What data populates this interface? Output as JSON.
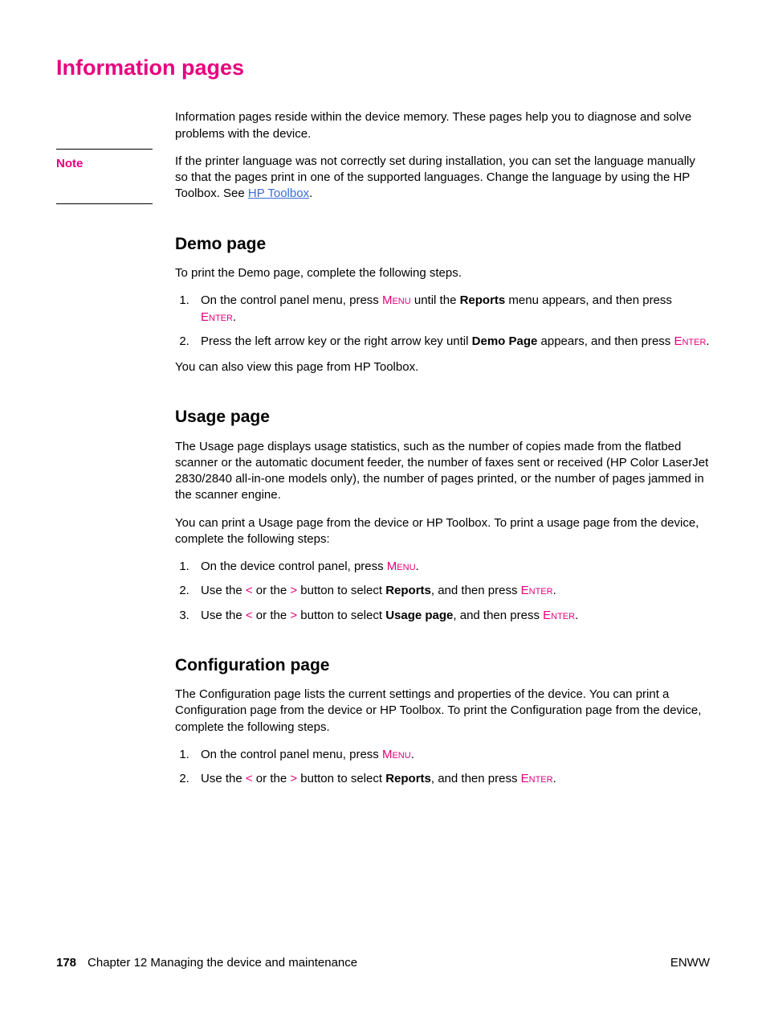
{
  "title": "Information pages",
  "intro": "Information pages reside within the device memory. These pages help you to diagnose and solve problems with the device.",
  "note": {
    "label": "Note",
    "body_pre": "If the printer language was not correctly set during installation, you can set the language manually so that the pages print in one of the supported languages. Change the language by using the HP Toolbox. See ",
    "link": "HP Toolbox",
    "body_post": "."
  },
  "demo": {
    "heading": "Demo page",
    "lead": "To print the Demo page, complete the following steps.",
    "step1_a": "On the control panel menu, press ",
    "step1_kw1": "Menu",
    "step1_b": " until the ",
    "step1_bold": "Reports",
    "step1_c": " menu appears, and then press ",
    "step1_kw2": "Enter",
    "step1_d": ".",
    "step2_a": "Press the left arrow key or the right arrow key until ",
    "step2_bold": "Demo Page",
    "step2_b": " appears, and then press ",
    "step2_kw": "Enter",
    "step2_c": ".",
    "tail": "You can also view this page from HP Toolbox."
  },
  "usage": {
    "heading": "Usage page",
    "p1": "The Usage page displays usage statistics, such as the number of copies made from the flatbed scanner or the automatic document feeder, the number of faxes sent or received (HP Color LaserJet 2830/2840 all-in-one models only), the number of pages printed, or the number of pages jammed in the scanner engine.",
    "p2": "You can print a Usage page from the device or HP Toolbox. To print a usage page from the device, complete the following steps:",
    "step1_a": "On the device control panel, press ",
    "step1_kw": "Menu",
    "step1_b": ".",
    "step2_a": "Use the ",
    "step2_lt": "<",
    "step2_b": " or the ",
    "step2_gt": ">",
    "step2_c": " button to select ",
    "step2_bold": "Reports",
    "step2_d": ", and then press ",
    "step2_kw": "Enter",
    "step2_e": ".",
    "step3_a": "Use the ",
    "step3_lt": "<",
    "step3_b": " or the ",
    "step3_gt": ">",
    "step3_c": " button to select ",
    "step3_bold": "Usage page",
    "step3_d": ", and then press ",
    "step3_kw": "Enter",
    "step3_e": "."
  },
  "config": {
    "heading": "Configuration page",
    "p1": "The Configuration page lists the current settings and properties of the device. You can print a Configuration page from the device or HP Toolbox. To print the Configuration page from the device, complete the following steps.",
    "step1_a": "On the control panel menu, press ",
    "step1_kw": "Menu",
    "step1_b": ".",
    "step2_a": "Use the ",
    "step2_lt": "<",
    "step2_b": " or the ",
    "step2_gt": ">",
    "step2_c": " button to select ",
    "step2_bold": "Reports",
    "step2_d": ", and then press ",
    "step2_kw": "Enter",
    "step2_e": "."
  },
  "footer": {
    "page": "178",
    "chapter": "Chapter 12  Managing the device and maintenance",
    "right": "ENWW"
  }
}
